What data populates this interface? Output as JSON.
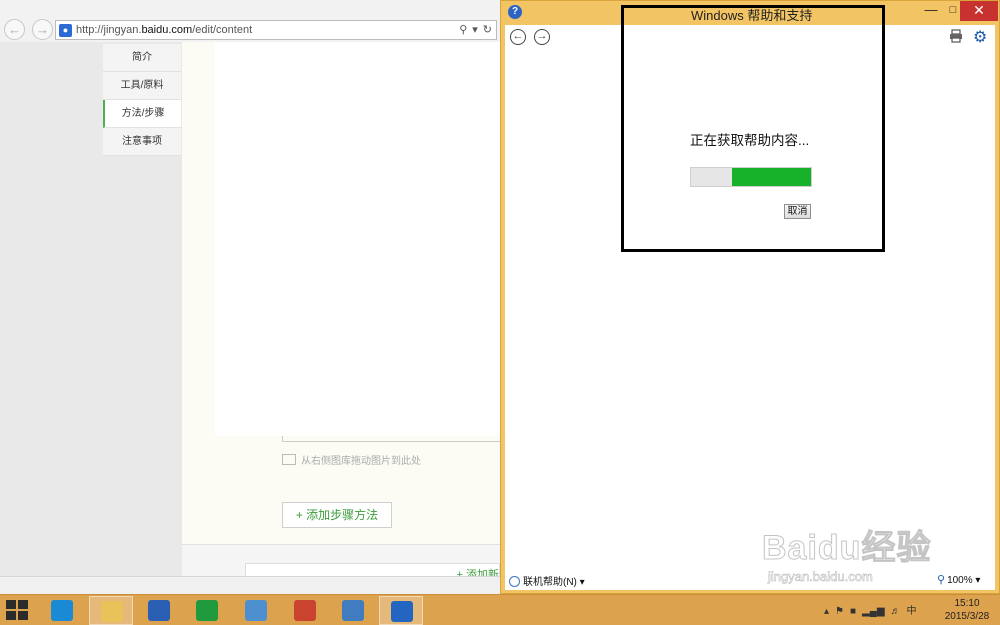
{
  "browser": {
    "url_prefix": "http://jingyan.",
    "url_domain": "baidu.com",
    "url_path": "/edit/content",
    "side_menu": [
      {
        "label": "简介",
        "active": false
      },
      {
        "label": "工具/原料",
        "active": false
      },
      {
        "label": "方法/步骤",
        "active": true
      },
      {
        "label": "注意事项",
        "active": false
      }
    ],
    "drag_hint": "从右侧图库拖动图片到此处",
    "add_step": "+ 添加步骤方法",
    "add_new": "+ 添加新"
  },
  "help_window": {
    "title": "Windows 帮助和支持",
    "loading_text": "正在获取帮助内容...",
    "progress": 0.66,
    "cancel_label": "取消",
    "online_help_label": "联机帮助(N)",
    "zoom_label": "100%",
    "icons": {
      "help": "help-icon",
      "back": "back-arrow-icon",
      "forward": "forward-arrow-icon",
      "print": "print-icon",
      "settings": "gear-icon"
    }
  },
  "taskbar": {
    "time": "15:10",
    "date": "2015/3/28",
    "apps": [
      {
        "name": "internet-explorer-icon",
        "color": "#1a8ad4"
      },
      {
        "name": "file-explorer-icon",
        "color": "#e9c35a"
      },
      {
        "name": "app-5-icon",
        "color": "#2a5fb3"
      },
      {
        "name": "store-icon",
        "color": "#1f9b3d"
      },
      {
        "name": "remote-desktop-icon",
        "color": "#4e8fd0"
      },
      {
        "name": "paint-icon",
        "color": "#c9432f"
      },
      {
        "name": "photo-viewer-icon",
        "color": "#3f7cc0"
      },
      {
        "name": "help-support-icon",
        "color": "#2465c2"
      }
    ]
  },
  "watermark": {
    "logo": "Baidu经验",
    "url": "jingyan.baidu.com"
  }
}
